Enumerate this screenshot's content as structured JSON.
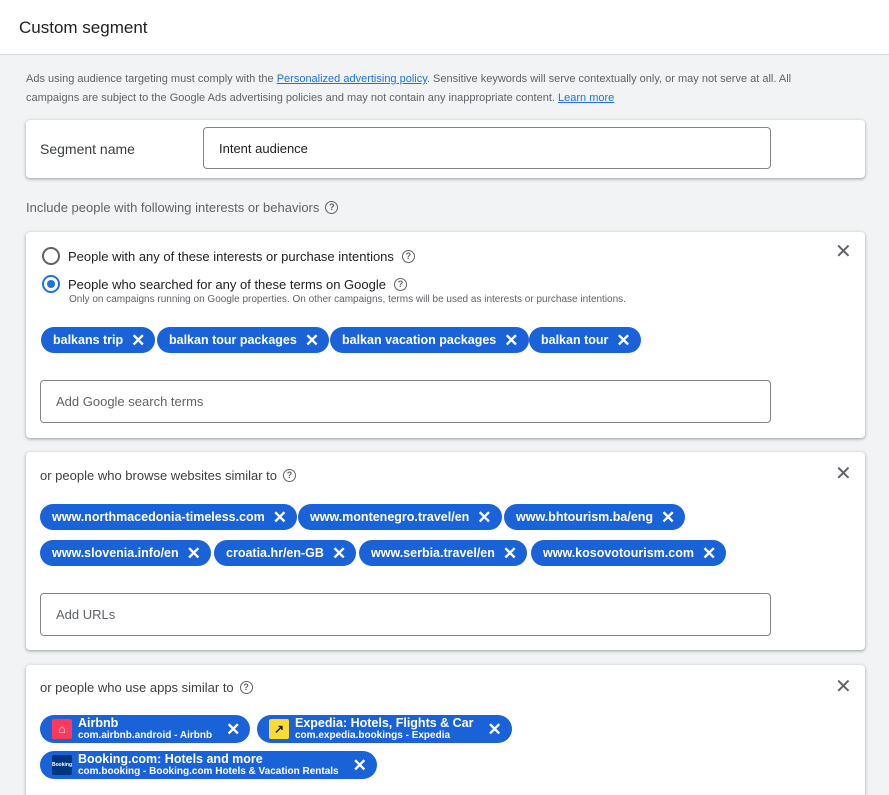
{
  "header": {
    "title": "Custom segment"
  },
  "notice": {
    "text_1": "Ads using audience targeting must comply with the ",
    "policy_link": "Personalized advertising policy",
    "text_2": ". Sensitive keywords will serve contextually only, or may not serve at all. All campaigns are subject to the Google Ads advertising policies and may not contain any inappropriate content. ",
    "learn_more": "Learn more"
  },
  "segment": {
    "label": "Segment name",
    "value": "Intent audience"
  },
  "include_label": "Include people with following interests or behaviors",
  "search_card": {
    "option_interests": "People with any of these interests or purchase intentions",
    "option_searched": "People who searched for any of these terms on Google",
    "selected": "searched",
    "note": "Only on campaigns running on Google properties. On other campaigns, terms will be used as interests or purchase intentions.",
    "terms": [
      "balkans trip",
      "balkan tour packages",
      "balkan vacation packages",
      "balkan tour"
    ],
    "input_placeholder": "Add Google search terms"
  },
  "websites_card": {
    "title": "or people who browse websites similar to",
    "urls": [
      "www.northmacedonia-timeless.com",
      "www.montenegro.travel/en",
      "www.bhtourism.ba/eng",
      "www.slovenia.info/en",
      "croatia.hr/en-GB",
      "www.serbia.travel/en",
      "www.kosovotourism.com"
    ],
    "input_placeholder": "Add URLs"
  },
  "apps_card": {
    "title": "or people who use apps similar to",
    "apps": [
      {
        "name": "Airbnb",
        "sub": "com.airbnb.android - Airbnb",
        "icon": "airbnb-icon",
        "color": "#ff385c"
      },
      {
        "name": "Expedia: Hotels, Flights & Car",
        "sub": "com.expedia.bookings - Expedia",
        "icon": "expedia-icon",
        "color": "#fddb32"
      },
      {
        "name": "Booking.com: Hotels and more",
        "sub": "com.booking - Booking.com Hotels & Vacation Rentals",
        "icon": "booking-icon",
        "color": "#003580"
      }
    ]
  },
  "colors": {
    "chip": "#1a62d8",
    "link": "#1a73e8"
  }
}
